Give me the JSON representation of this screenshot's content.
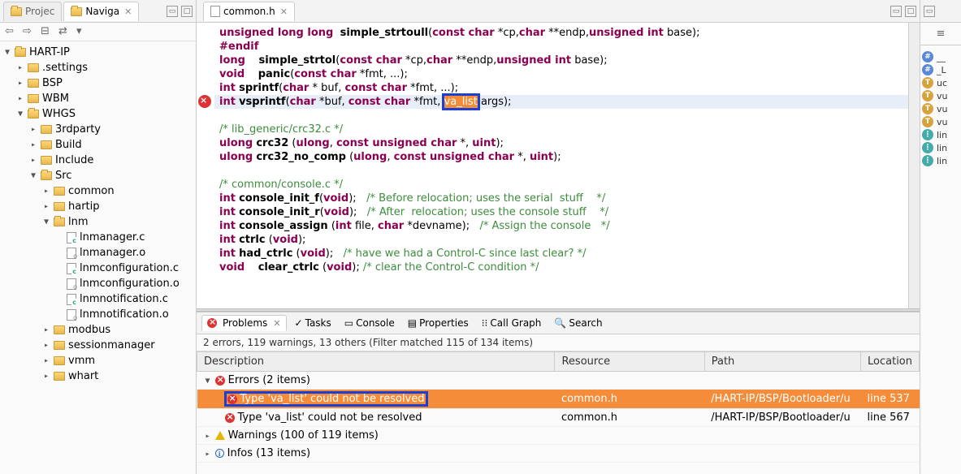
{
  "left": {
    "tabs": [
      {
        "label": "Projec",
        "active": false
      },
      {
        "label": "Naviga",
        "active": true
      }
    ],
    "tree": {
      "root": "HART-IP",
      "children": [
        {
          "label": ".settings",
          "type": "folder",
          "indent": 1,
          "open": false
        },
        {
          "label": "BSP",
          "type": "folder",
          "indent": 1,
          "open": false
        },
        {
          "label": "WBM",
          "type": "folder",
          "indent": 1,
          "open": false
        },
        {
          "label": "WHGS",
          "type": "folder",
          "indent": 1,
          "open": true
        },
        {
          "label": "3rdparty",
          "type": "folder",
          "indent": 2,
          "open": false
        },
        {
          "label": "Build",
          "type": "folder",
          "indent": 2,
          "open": false
        },
        {
          "label": "Include",
          "type": "folder",
          "indent": 2,
          "open": false
        },
        {
          "label": "Src",
          "type": "folder",
          "indent": 2,
          "open": true
        },
        {
          "label": "common",
          "type": "folder",
          "indent": 3,
          "open": false
        },
        {
          "label": "hartip",
          "type": "folder",
          "indent": 3,
          "open": false
        },
        {
          "label": "lnm",
          "type": "folder",
          "indent": 3,
          "open": true
        },
        {
          "label": "lnmanager.c",
          "type": "c",
          "indent": 4
        },
        {
          "label": "lnmanager.o",
          "type": "o",
          "indent": 4
        },
        {
          "label": "lnmconfiguration.c",
          "type": "c",
          "indent": 4
        },
        {
          "label": "lnmconfiguration.o",
          "type": "o",
          "indent": 4
        },
        {
          "label": "lnmnotification.c",
          "type": "c",
          "indent": 4
        },
        {
          "label": "lnmnotification.o",
          "type": "o",
          "indent": 4
        },
        {
          "label": "modbus",
          "type": "folder",
          "indent": 3,
          "open": false
        },
        {
          "label": "sessionmanager",
          "type": "folder",
          "indent": 3,
          "open": false
        },
        {
          "label": "vmm",
          "type": "folder",
          "indent": 3,
          "open": false
        },
        {
          "label": "whart",
          "type": "folder",
          "indent": 3,
          "open": false
        }
      ]
    }
  },
  "editor": {
    "tab": "common.h",
    "lines": [
      {
        "html": "<span class='kw'>unsigned long long</span>  <span class='fname'>simple_strtoull</span>(<span class='kw'>const char</span> *cp,<span class='kw'>char</span> **endp,<span class='kw'>unsigned int</span> base);"
      },
      {
        "html": "<span class='kw'>#endif</span>"
      },
      {
        "html": "<span class='kw'>long</span>    <span class='fname'>simple_strtol</span>(<span class='kw'>const char</span> *cp,<span class='kw'>char</span> **endp,<span class='kw'>unsigned int</span> base);"
      },
      {
        "html": "<span class='kw'>void</span>    <span class='fname'>panic</span>(<span class='kw'>const char</span> *fmt, ...);"
      },
      {
        "html": "<span class='kw'>int</span> <span class='fname'>sprintf</span>(<span class='kw'>char</span> * buf, <span class='kw'>const char</span> *fmt, ...);"
      },
      {
        "html": "<span class='kw'>int</span> <span class='fname'>vsprintf</span>(<span class='kw'>char</span> *buf, <span class='kw'>const char</span> *fmt, <span class='highlight-sel'>va_list</span> args);",
        "error": true,
        "cursor": true
      },
      {
        "html": ""
      },
      {
        "html": "<span class='comment'>/* lib_generic/crc32.c */</span>"
      },
      {
        "html": "<span class='kw'>ulong</span> <span class='fname'>crc32</span> (<span class='kw'>ulong</span>, <span class='kw'>const unsigned char</span> *, <span class='kw'>uint</span>);"
      },
      {
        "html": "<span class='kw'>ulong</span> <span class='fname'>crc32_no_comp</span> (<span class='kw'>ulong</span>, <span class='kw'>const unsigned char</span> *, <span class='kw'>uint</span>);"
      },
      {
        "html": ""
      },
      {
        "html": "<span class='comment'>/* common/console.c */</span>"
      },
      {
        "html": "<span class='kw'>int</span> <span class='fname'>console_init_f</span>(<span class='kw'>void</span>);   <span class='comment'>/* Before relocation; uses the serial  stuff    */</span>"
      },
      {
        "html": "<span class='kw'>int</span> <span class='fname'>console_init_r</span>(<span class='kw'>void</span>);   <span class='comment'>/* After  relocation; uses the console stuff    */</span>"
      },
      {
        "html": "<span class='kw'>int</span> <span class='fname'>console_assign</span> (<span class='kw'>int</span> file, <span class='kw'>char</span> *devname);   <span class='comment'>/* Assign the console   */</span>"
      },
      {
        "html": "<span class='kw'>int</span> <span class='fname'>ctrlc</span> (<span class='kw'>void</span>);"
      },
      {
        "html": "<span class='kw'>int</span> <span class='fname'>had_ctrlc</span> (<span class='kw'>void</span>);   <span class='comment'>/* have we had a Control-C since last clear? */</span>"
      },
      {
        "html": "<span class='kw'>void</span>    <span class='fname'>clear_ctrlc</span> (<span class='kw'>void</span>); <span class='comment'>/* clear the Control-C condition */</span>"
      }
    ]
  },
  "problems": {
    "tabs": [
      "Problems",
      "Tasks",
      "Console",
      "Properties",
      "Call Graph",
      "Search"
    ],
    "filter": "2 errors, 119 warnings, 13 others (Filter matched 115 of 134 items)",
    "columns": [
      "Description",
      "Resource",
      "Path",
      "Location"
    ],
    "groups": {
      "errors_header": "Errors (2 items)",
      "warnings_header": "Warnings (100 of 119 items)",
      "infos_header": "Infos (13 items)"
    },
    "errors": [
      {
        "desc": "Type 'va_list' could not be resolved",
        "res": "common.h",
        "path": "/HART-IP/BSP/Bootloader/u",
        "loc": "line 537",
        "selected": true
      },
      {
        "desc": "Type 'va_list' could not be resolved",
        "res": "common.h",
        "path": "/HART-IP/BSP/Bootloader/u",
        "loc": "line 567",
        "selected": false
      }
    ]
  },
  "outline": {
    "items": [
      {
        "badge": "#",
        "cls": "ob-inc",
        "label": "__"
      },
      {
        "badge": "#",
        "cls": "ob-inc",
        "label": "_L"
      },
      {
        "badge": "T",
        "cls": "ob-func",
        "label": "uc"
      },
      {
        "badge": "T",
        "cls": "ob-func",
        "label": "vu"
      },
      {
        "badge": "T",
        "cls": "ob-func",
        "label": "vu"
      },
      {
        "badge": "T",
        "cls": "ob-func",
        "label": "vu"
      },
      {
        "badge": "⋮",
        "cls": "ob-type",
        "label": "lin"
      },
      {
        "badge": "⋮",
        "cls": "ob-type",
        "label": "lin"
      },
      {
        "badge": "⋮",
        "cls": "ob-type",
        "label": "lin"
      }
    ]
  }
}
